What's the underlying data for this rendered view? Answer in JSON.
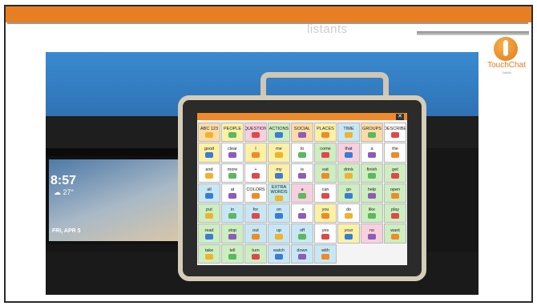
{
  "slide": {
    "title_fragment": "listants",
    "logo_text": "TouchChat",
    "logo_subtext": "Saltillo",
    "accent_color": "#e77f22"
  },
  "photo": {
    "echo_time": "8:57",
    "echo_temp": "☁ 27°",
    "echo_date": "FRI, APR 5",
    "close_symbol": "✕",
    "board_cells": [
      "ABC 123",
      "PEOPLE",
      "QUESTION",
      "ACTIONS",
      "SOCIAL",
      "PLACES",
      "TIME",
      "GROUPS",
      "DESCRIBE",
      "good",
      "clear",
      "I",
      "me",
      "to",
      "come",
      "that",
      "a",
      "the",
      "and",
      "more",
      "+",
      "my",
      "is",
      "eat",
      "drink",
      "finish",
      "get",
      "all",
      "at",
      "COLORS",
      "EXTRA WORDS",
      "a",
      "can",
      "go",
      "help",
      "open",
      "put",
      "in",
      "for",
      "on",
      "-s",
      "you",
      "do",
      "like",
      "play",
      "read",
      "stop",
      "out",
      "up",
      "off",
      "yes",
      "your",
      "no",
      "want",
      "take",
      "tell",
      "turn",
      "watch",
      "down",
      "with"
    ]
  }
}
